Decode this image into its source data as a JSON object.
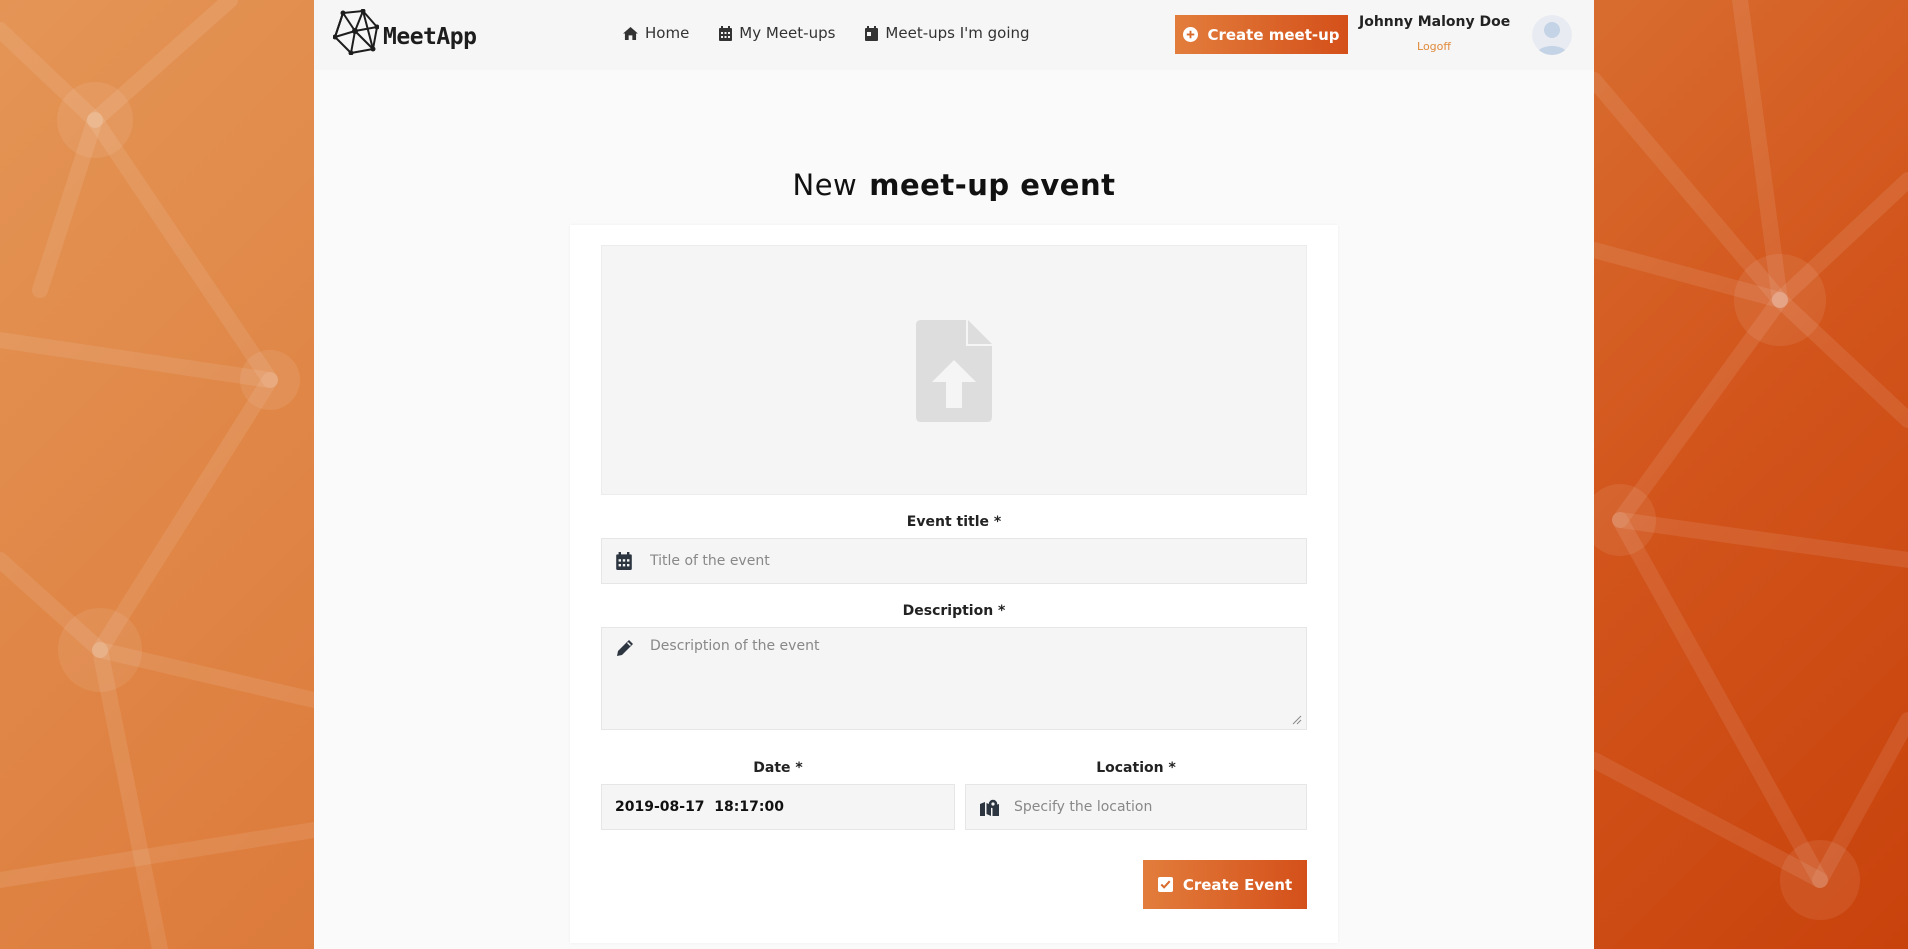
{
  "brand": {
    "name": "MeetApp"
  },
  "nav": {
    "items": [
      {
        "label": "Home",
        "icon": "home-icon"
      },
      {
        "label": "My Meet-ups",
        "icon": "calendar-icon"
      },
      {
        "label": "Meet-ups I'm going",
        "icon": "calendar-day-icon"
      }
    ],
    "create_label": "Create meet-up"
  },
  "user": {
    "name": "Johnny Malony Doe",
    "logoff_label": "Logoff"
  },
  "page": {
    "title_light": "New",
    "title_bold": "meet-up event"
  },
  "form": {
    "title_label": "Event title *",
    "title_placeholder": "Title of the event",
    "description_label": "Description *",
    "description_placeholder": "Description of the event",
    "date_label": "Date *",
    "date_value": "2019-08-17  18:17:00",
    "location_label": "Location *",
    "location_placeholder": "Specify the location",
    "submit_label": "Create Event"
  },
  "colors": {
    "accent_start": "#e27d3c",
    "accent_end": "#d4501a",
    "link": "#e08a3c",
    "background_gradient": [
      "#e49556",
      "#c8420c"
    ]
  }
}
